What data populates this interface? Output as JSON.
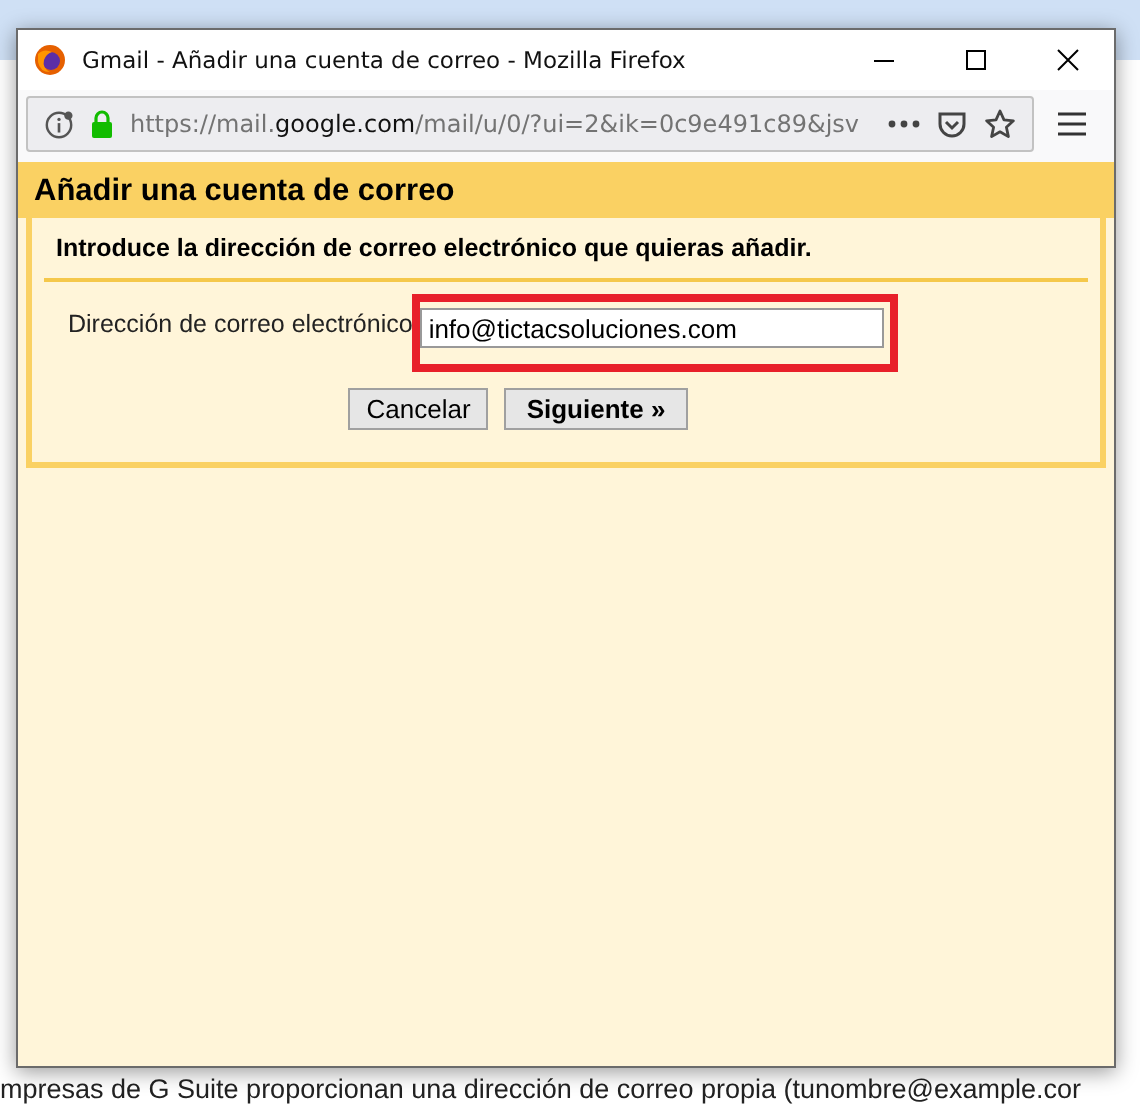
{
  "window": {
    "title": "Gmail - Añadir una cuenta de correo - Mozilla Firefox"
  },
  "address_bar": {
    "url_prefix": "https://mail.",
    "url_domain": "google.com",
    "url_rest": "/mail/u/0/?ui=2&ik=0c9e491c89&jsv",
    "secure": true
  },
  "dialog": {
    "title": "Añadir una cuenta de correo",
    "instruction": "Introduce la dirección de correo electrónico que quieras añadir.",
    "field_label": "Dirección de correo electrónico",
    "field_value": "info@tictacsoluciones.com",
    "highlighted": true,
    "buttons": [
      {
        "label": "Cancelar",
        "kind": "secondary"
      },
      {
        "label": "Siguiente »",
        "kind": "primary"
      }
    ]
  },
  "background_text": "mpresas de G Suite proporcionan una dirección de correo propia (tunombre@example.cor"
}
